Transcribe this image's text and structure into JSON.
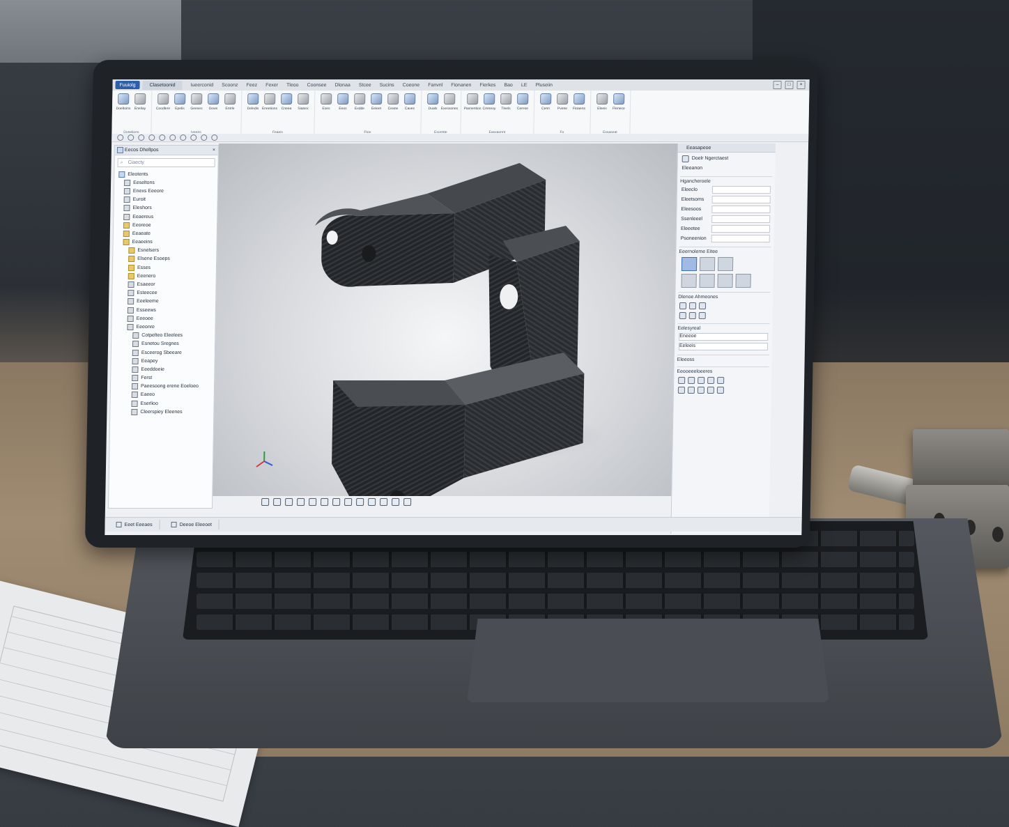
{
  "titlebar": {
    "app_label": "Fuuiolg",
    "doc_tab": "Clasetoonid",
    "menus": [
      "Iueerconid",
      "Scoonz",
      "Feez",
      "Fexer",
      "Tleoo",
      "Coonsee",
      "Dlonaa",
      "Stcee",
      "Sucins",
      "Coeone",
      "Fanvnl",
      "Fionanen",
      "Fierkes",
      "Bao",
      "LE",
      "Pluseiin"
    ]
  },
  "ribbon": {
    "groups": [
      {
        "name": "Donelions",
        "buttons": [
          "Doeltoins",
          "Eneliay"
        ]
      },
      {
        "name": "Iveeirs",
        "buttons": [
          "Coodlere",
          "Epelis",
          "Geeses",
          "Dows",
          "Entrle"
        ]
      },
      {
        "name": "Feaeis",
        "buttons": [
          "Deledis",
          "Eneetions",
          "Cneea",
          "Sianex"
        ]
      },
      {
        "name": "Ftoe",
        "buttons": [
          "Exes",
          "Eeos",
          "Exdde",
          "Eeieet",
          "Ceane",
          "Caves"
        ]
      },
      {
        "name": "Esorntte",
        "buttons": [
          "Duals",
          "Exessones"
        ]
      },
      {
        "name": "Easxaonnt",
        "buttons": [
          "Pasnentios",
          "Creneoy",
          "Tleels",
          "Cerese"
        ]
      },
      {
        "name": "Fo",
        "buttons": [
          "Cenn",
          "Pvene",
          "Ftoaens"
        ]
      },
      {
        "name": "Essaseat",
        "buttons": [
          "Eleeis",
          "Flenece"
        ]
      }
    ]
  },
  "feature_tree": {
    "header": "Eecos Dhellpos",
    "search_placeholder": "Ciaecty",
    "items": [
      {
        "label": "Eleotents",
        "indent": 0,
        "type": "part"
      },
      {
        "label": "Eeseltons",
        "indent": 1,
        "type": "feature"
      },
      {
        "label": "Enexs Eeeore",
        "indent": 1,
        "type": "feature"
      },
      {
        "label": "Euroit",
        "indent": 1,
        "type": "feature"
      },
      {
        "label": "Eleshors",
        "indent": 1,
        "type": "feature"
      },
      {
        "label": "Eeaereus",
        "indent": 1,
        "type": "feature"
      },
      {
        "label": "Eeoreoe",
        "indent": 1,
        "type": "folder"
      },
      {
        "label": "Eeaeate",
        "indent": 1,
        "type": "folder"
      },
      {
        "label": "Eeaeeins",
        "indent": 1,
        "type": "folder"
      },
      {
        "label": "Esnelsers",
        "indent": 2,
        "type": "folder"
      },
      {
        "label": "Elsene Esoeps",
        "indent": 2,
        "type": "folder"
      },
      {
        "label": "Esses",
        "indent": 2,
        "type": "folder"
      },
      {
        "label": "Eeenero",
        "indent": 2,
        "type": "folder"
      },
      {
        "label": "Esaeeor",
        "indent": 2,
        "type": "feature"
      },
      {
        "label": "Esteecee",
        "indent": 2,
        "type": "feature"
      },
      {
        "label": "Eeeleeme",
        "indent": 2,
        "type": "feature"
      },
      {
        "label": "Esseews",
        "indent": 2,
        "type": "feature"
      },
      {
        "label": "Eeeoee",
        "indent": 2,
        "type": "feature"
      },
      {
        "label": "Eeeonre",
        "indent": 2,
        "type": "feature"
      },
      {
        "label": "Cotpelteo Eleelees",
        "indent": 3,
        "type": "feature"
      },
      {
        "label": "Esnetou Sregnes",
        "indent": 3,
        "type": "feature"
      },
      {
        "label": "Esceerog Sbeeare",
        "indent": 3,
        "type": "feature"
      },
      {
        "label": "Eeapey",
        "indent": 3,
        "type": "feature"
      },
      {
        "label": "Eeeddoeie",
        "indent": 3,
        "type": "feature"
      },
      {
        "label": "Ferst",
        "indent": 3,
        "type": "feature"
      },
      {
        "label": "Paeesoong erene Eoeloeo",
        "indent": 3,
        "type": "feature"
      },
      {
        "label": "Eaeeo",
        "indent": 3,
        "type": "feature"
      },
      {
        "label": "Eserlioo",
        "indent": 3,
        "type": "feature"
      },
      {
        "label": "Cleerspiey Eleenes",
        "indent": 3,
        "type": "feature"
      }
    ]
  },
  "properties": {
    "header": "Eeasapeoe",
    "subheader": "Doelr Ngerctaest",
    "section_label": "Eleeanon",
    "group_label": "Hgancheroele",
    "rows": [
      "Eleeclo",
      "Eleetsoms",
      "Eleesoos",
      "Ssenleeel",
      "Eleeetee",
      "Psoneenion"
    ],
    "appearance_label": "Eeernoleme Eitee",
    "selection_label": "Dlenoe Ahmeones",
    "display_label": "Eelesyreal",
    "display_options": [
      "Eneeoe",
      "Eeleeis"
    ],
    "footer_label": "Eleeoss",
    "tools_label": "Eeooeeeloeeres"
  },
  "status": {
    "tabs": [
      "Eeet Eeeaes",
      "Deeoe Eleeoet"
    ]
  },
  "colors": {
    "accent": "#2d5ea8",
    "part": "#2b2d30",
    "viewport_bg": "#d7d9dd"
  }
}
